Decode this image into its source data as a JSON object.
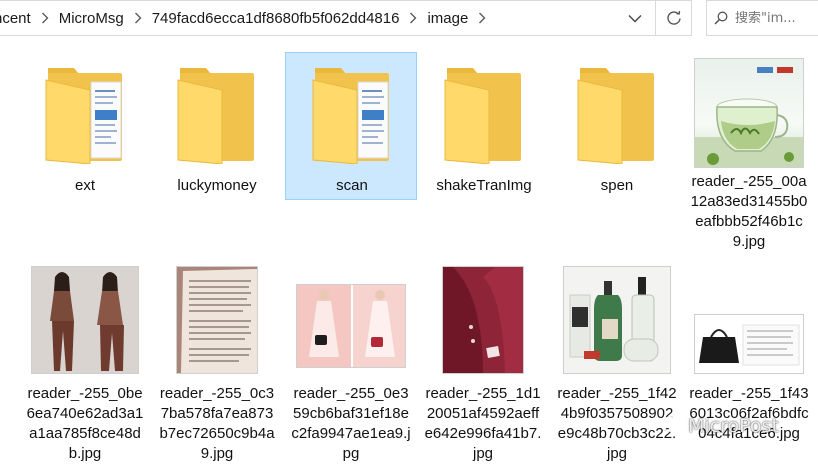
{
  "address_bar": {
    "breadcrumbs": [
      "ncent",
      "MicroMsg",
      "749facd6ecca1df8680fb5f062dd4816",
      "image"
    ]
  },
  "search": {
    "placeholder": "搜索\"im..."
  },
  "items": [
    {
      "name": "ext",
      "kind": "folder"
    },
    {
      "name": "luckymoney",
      "kind": "folder"
    },
    {
      "name": "scan",
      "kind": "folder",
      "selected": true
    },
    {
      "name": "shakeTranImg",
      "kind": "folder"
    },
    {
      "name": "spen",
      "kind": "folder"
    },
    {
      "name": "reader_-255_00a12a83ed31455b0eafbbb52f46b1c9.jpg",
      "kind": "image",
      "thumb": "tea-glass"
    },
    {
      "name": "reader_-255_0be6ea740e62ad3a1a1aa785f8ce48db.jpg",
      "kind": "image",
      "thumb": "fashion-outfit"
    },
    {
      "name": "reader_-255_0c37ba578fa7ea873b7ec72650c9b4a9.jpg",
      "kind": "image",
      "thumb": "book-page"
    },
    {
      "name": "reader_-255_0e359cb6baf31ef18ec2fa9947ae1ea9.jpg",
      "kind": "image",
      "thumb": "dress-with-bag"
    },
    {
      "name": "reader_-255_1d120051af4592aeffe642e996fa41b7.jpg",
      "kind": "image",
      "thumb": "red-jacket"
    },
    {
      "name": "reader_-255_1f424b9f0357508902e9c48b70cb3c22.jpg",
      "kind": "image",
      "thumb": "skincare-bottles"
    },
    {
      "name": "reader_-255_1f436013c06f2af6bdfc04c4fa1ce6.jpg",
      "kind": "image",
      "thumb": "black-handbag"
    }
  ],
  "watermark": "MicroPost",
  "colors": {
    "selection_fill": "#cce8ff",
    "selection_border": "#99d1ff",
    "folder_yellow": "#ffd969"
  }
}
